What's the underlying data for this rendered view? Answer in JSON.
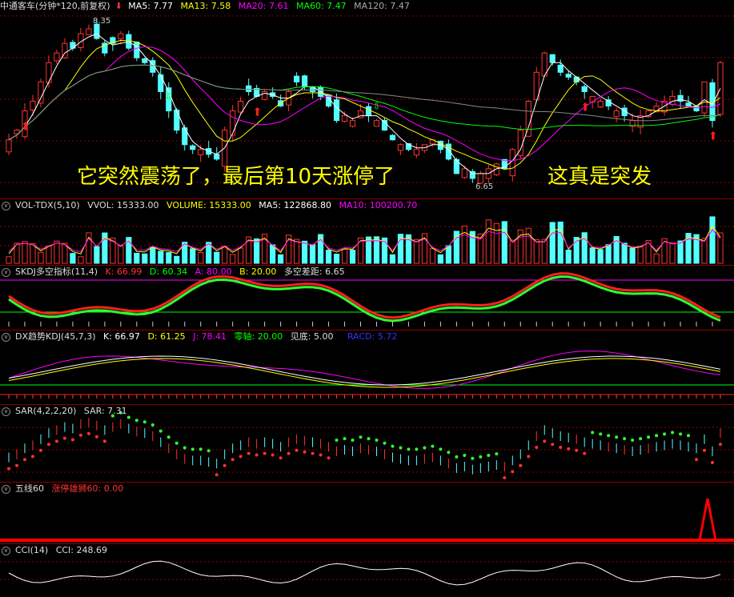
{
  "colors": {
    "up": "#ff3232",
    "down": "#54ffff",
    "ma5": "#ffffff",
    "ma13": "#ffff00",
    "ma20": "#ff00ff",
    "ma60": "#00ff00",
    "ma120": "#888888",
    "grid": "#8b0000"
  },
  "main": {
    "title": "中通客车(分钟*120,前复权)",
    "ma5": "MA5: 7.77",
    "ma13": "MA13: 7.58",
    "ma20": "MA20: 7.61",
    "ma60": "MA60: 7.47",
    "ma120": "MA120: 7.47",
    "high_label": "8.35",
    "low_label": "6.65",
    "annotation_left": "它突然震荡了，最后第10天涨停了",
    "annotation_right": "这真是突发"
  },
  "vol": {
    "title": "VOL-TDX(5,10)",
    "vvol": "VVOL: 15333.00",
    "volume": "VOLUME: 15333.00",
    "ma5": "MA5: 122868.80",
    "ma10": "MA10: 100200.70"
  },
  "skdj": {
    "title": "SKDJ多空指标(11,4)",
    "k": "K: 66.99",
    "d": "D: 60.34",
    "a": "A: 80.00",
    "b": "B: 20.00",
    "diff": "多空差距: 6.65"
  },
  "dxkdj": {
    "title": "DX趋势KDJ(45,7,3)",
    "k": "K: 66.97",
    "d": "D: 61.25",
    "j": "J: 78.41",
    "zero": "零轴: 20.00",
    "bottom": "见底: 5.00",
    "racd": "RACD: 5.72"
  },
  "sar": {
    "title": "SAR(4,2,2,20)",
    "value": "SAR: 7.31"
  },
  "five": {
    "title": "五线60",
    "limit": "涨停雄狮60: 0.00"
  },
  "cci": {
    "title": "CCI(14)",
    "value": "CCI: 248.69"
  },
  "chart_data": {
    "type": "candlestick",
    "ylim": [
      6.6,
      8.4
    ],
    "close": [
      7.1,
      7.2,
      7.4,
      7.5,
      7.7,
      7.9,
      8.0,
      8.1,
      8.05,
      8.2,
      8.25,
      8.15,
      8.0,
      8.1,
      8.2,
      8.05,
      7.95,
      7.9,
      7.8,
      7.6,
      7.4,
      7.2,
      7.05,
      7.0,
      7.0,
      6.95,
      6.9,
      7.2,
      7.4,
      7.5,
      7.6,
      7.55,
      7.6,
      7.55,
      7.45,
      7.6,
      7.7,
      7.65,
      7.6,
      7.55,
      7.45,
      7.3,
      7.35,
      7.3,
      7.4,
      7.35,
      7.3,
      7.2,
      7.1,
      7.05,
      7.0,
      7.0,
      7.05,
      7.1,
      7.0,
      6.9,
      6.75,
      6.8,
      6.7,
      6.75,
      6.8,
      6.85,
      6.8,
      7.0,
      7.2,
      7.5,
      7.8,
      8.0,
      7.9,
      7.8,
      7.75,
      7.7,
      7.6,
      7.55,
      7.5,
      7.45,
      7.4,
      7.35,
      7.3,
      7.35,
      7.4,
      7.45,
      7.5,
      7.55,
      7.5,
      7.45,
      7.4,
      7.7,
      7.3,
      7.9
    ]
  }
}
